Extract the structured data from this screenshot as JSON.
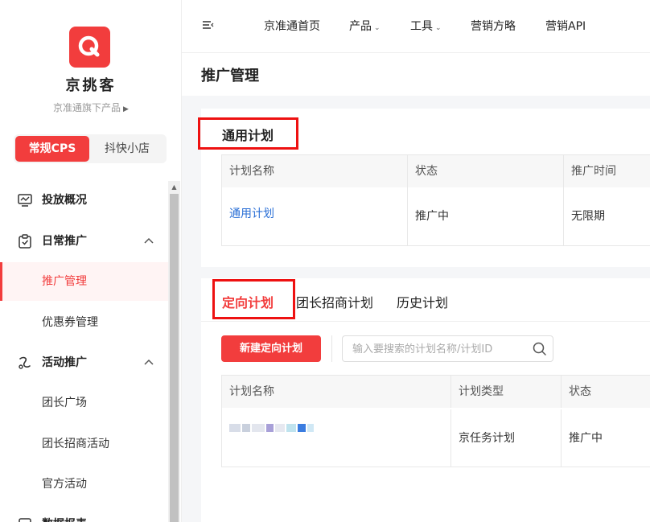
{
  "brand": {
    "name": "京挑客",
    "subtitle": "京准通旗下产品",
    "logo_color": "#f23d3d"
  },
  "mode_tabs": [
    {
      "label": "常规CPS",
      "active": true
    },
    {
      "label": "抖快小店",
      "active": false
    }
  ],
  "sidebar": {
    "overview": {
      "label": "投放概况",
      "icon": "monitor-chart-icon"
    },
    "daily": {
      "label": "日常推广",
      "icon": "clipboard-check-icon",
      "expanded": true,
      "children": [
        {
          "label": "推广管理",
          "active": true
        },
        {
          "label": "优惠券管理",
          "active": false
        }
      ]
    },
    "activity": {
      "label": "活动推广",
      "icon": "activity-icon",
      "expanded": true,
      "children": [
        {
          "label": "团长广场"
        },
        {
          "label": "团长招商活动"
        },
        {
          "label": "官方活动"
        }
      ]
    },
    "next_partial": {
      "label": "数据报表"
    }
  },
  "topnav": {
    "items": [
      {
        "label": "京准通首页",
        "dropdown": false
      },
      {
        "label": "产品",
        "dropdown": true
      },
      {
        "label": "工具",
        "dropdown": true
      },
      {
        "label": "营销方略",
        "dropdown": false
      },
      {
        "label": "营销API",
        "dropdown": false
      }
    ]
  },
  "page_title": "推广管理",
  "general_plan": {
    "title": "通用计划",
    "columns": [
      "计划名称",
      "状态",
      "推广时间"
    ],
    "rows": [
      {
        "name": "通用计划",
        "status": "推广中",
        "time": "无限期"
      }
    ]
  },
  "plan_tabs": [
    {
      "label": "定向计划",
      "active": true
    },
    {
      "label": "团长招商计划",
      "active": false
    },
    {
      "label": "历史计划",
      "active": false
    }
  ],
  "targeted_plan": {
    "new_button": "新建定向计划",
    "search_placeholder": "输入要搜索的计划名称/计划ID",
    "columns": [
      "计划名称",
      "计划类型",
      "状态"
    ],
    "rows": [
      {
        "name": "",
        "type": "京任务计划",
        "status": "推广中"
      }
    ]
  },
  "colors": {
    "accent": "#f23d3d",
    "link": "#2a6fd6",
    "highlight_box": "#ee1111"
  }
}
